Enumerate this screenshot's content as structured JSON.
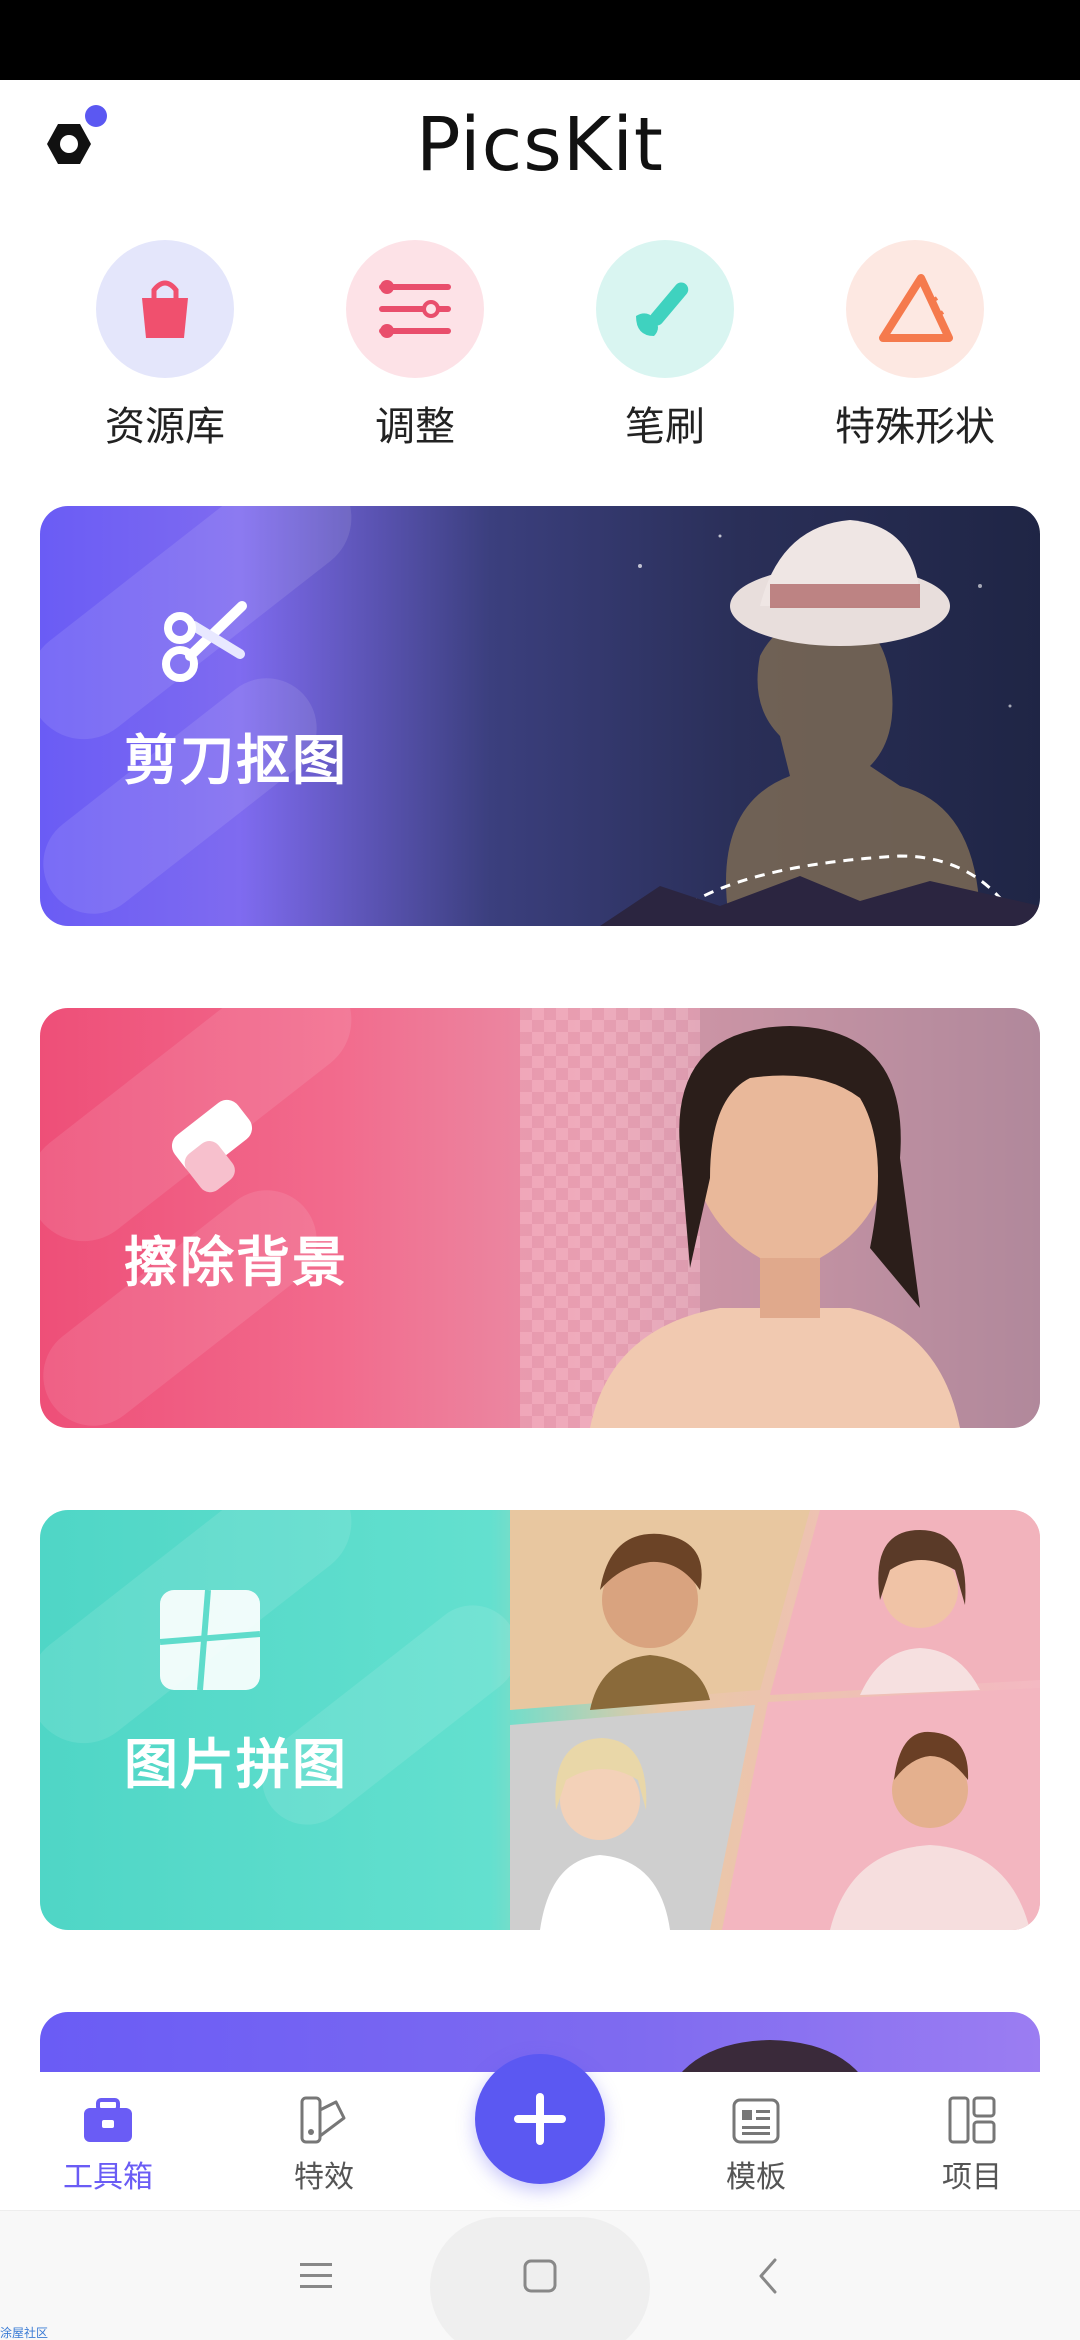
{
  "app": {
    "title": "PicsKit"
  },
  "quick_tools": [
    {
      "label": "资源库",
      "icon": "shopping-bag-icon",
      "bg": "#e4e6fb",
      "color": "#f0506e"
    },
    {
      "label": "调整",
      "icon": "sliders-icon",
      "bg": "#fde2e7",
      "color": "#e94e6c"
    },
    {
      "label": "笔刷",
      "icon": "brush-icon",
      "bg": "#d9f5f1",
      "color": "#3fd2bf"
    },
    {
      "label": "特殊形状",
      "icon": "triangle-ruler-icon",
      "bg": "#fde8e2",
      "color": "#f57a4d"
    }
  ],
  "cards": [
    {
      "title": "剪刀抠图",
      "icon": "scissors-icon"
    },
    {
      "title": "擦除背景",
      "icon": "eraser-icon"
    },
    {
      "title": "图片拼图",
      "icon": "collage-icon"
    }
  ],
  "bottom_nav": [
    {
      "label": "工具箱",
      "icon": "toolbox-icon",
      "active": true
    },
    {
      "label": "特效",
      "icon": "effects-icon",
      "active": false
    },
    {
      "label": "模板",
      "icon": "template-icon",
      "active": false
    },
    {
      "label": "项目",
      "icon": "projects-icon",
      "active": false
    }
  ],
  "footer": {
    "text": "涂屋社区"
  },
  "colors": {
    "accent": "#5b58f2",
    "active_nav": "#6a5cf5"
  }
}
